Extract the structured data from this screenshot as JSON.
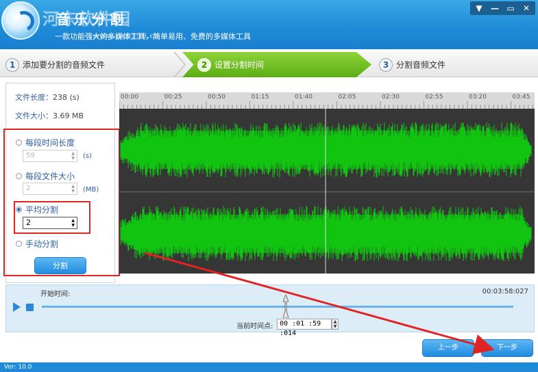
{
  "header": {
    "watermark": "河东软件园",
    "title": "音乐分割",
    "subtitle": "一款功能强大的多媒体工具，简单易用、免费的多媒体工具",
    "watermark_url": "www.pc0359.cn",
    "window_buttons": [
      "▼",
      "—",
      "▭",
      "✕"
    ]
  },
  "steps": [
    {
      "num": "1",
      "label": "添加要分割的音频文件"
    },
    {
      "num": "2",
      "label": "设置分割时间"
    },
    {
      "num": "3",
      "label": "分割音频文件"
    }
  ],
  "file_info": {
    "length_label": "文件长度：",
    "length_value": "238 (s)",
    "size_label": "文件大小：",
    "size_value": "3.69 MB"
  },
  "options": {
    "per_time": {
      "label": "每段时间长度",
      "value": "59",
      "unit": "(s)",
      "selected": false
    },
    "per_size": {
      "label": "每段文件大小",
      "value": "2",
      "unit": "(MB)",
      "selected": false
    },
    "average": {
      "label": "平均分割",
      "value": "2",
      "selected": true
    },
    "manual": {
      "label": "手动分割",
      "selected": false
    },
    "split_button": "分割"
  },
  "ruler_ticks": [
    "00:00",
    "00:25",
    "00:50",
    "01:15",
    "01:40",
    "02:05",
    "02:30",
    "02:55",
    "03:20",
    "03:45"
  ],
  "waveform": {
    "color": "#11c411",
    "split_marker": "01:59"
  },
  "playback": {
    "start_label": "开始时间:",
    "end_time": "00:03:58:027",
    "current_label": "当前时间点:",
    "current_value": "00 :01 :59 :014"
  },
  "nav": {
    "prev": "上一步",
    "next": "下一步"
  },
  "status": {
    "version": "Ver: 10.0"
  },
  "colors": {
    "accent": "#1e8ad8",
    "step_active": "#5bae14",
    "annotation": "#e02424"
  }
}
